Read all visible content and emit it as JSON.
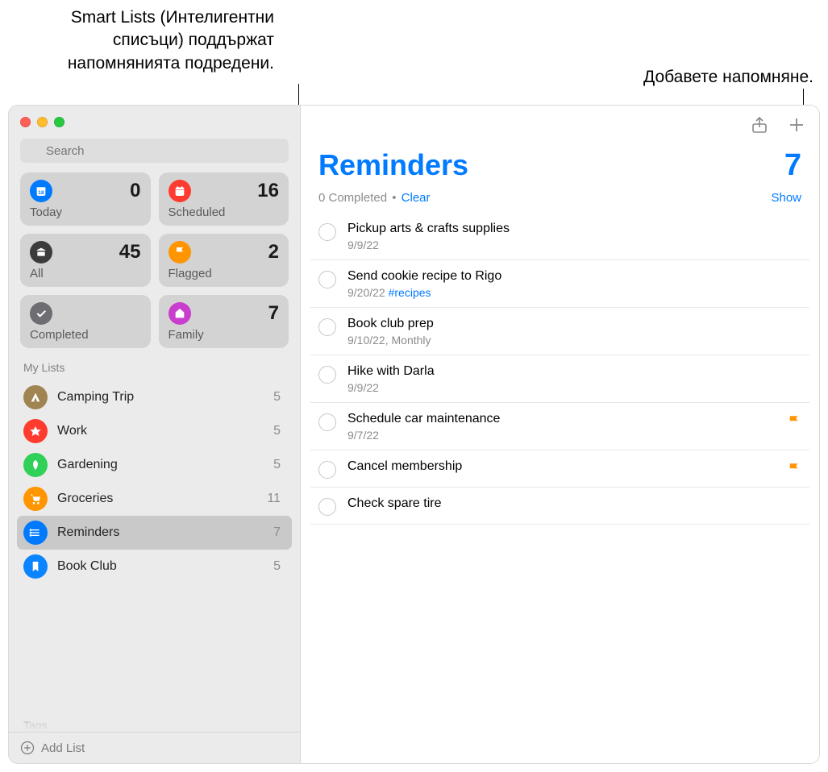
{
  "callouts": {
    "left": "Smart Lists (Интелигентни списъци) поддържат напомнянията подредени.",
    "right": "Добавете напомняне."
  },
  "sidebar": {
    "search_placeholder": "Search",
    "smart": [
      {
        "label": "Today",
        "count": "0",
        "icon": "today"
      },
      {
        "label": "Scheduled",
        "count": "16",
        "icon": "scheduled"
      },
      {
        "label": "All",
        "count": "45",
        "icon": "all"
      },
      {
        "label": "Flagged",
        "count": "2",
        "icon": "flagged"
      },
      {
        "label": "Completed",
        "count": "",
        "icon": "completed"
      },
      {
        "label": "Family",
        "count": "7",
        "icon": "family"
      }
    ],
    "my_lists_title": "My Lists",
    "lists": [
      {
        "name": "Camping Trip",
        "count": "5",
        "cls": "ic-camping"
      },
      {
        "name": "Work",
        "count": "5",
        "cls": "ic-work"
      },
      {
        "name": "Gardening",
        "count": "5",
        "cls": "ic-garden"
      },
      {
        "name": "Groceries",
        "count": "11",
        "cls": "ic-groc"
      },
      {
        "name": "Reminders",
        "count": "7",
        "cls": "ic-remind",
        "selected": true
      },
      {
        "name": "Book Club",
        "count": "5",
        "cls": "ic-book"
      }
    ],
    "tags_title": "Tags",
    "add_list": "Add List"
  },
  "content": {
    "title": "Reminders",
    "count": "7",
    "completed_text": "0 Completed",
    "clear": "Clear",
    "show": "Show",
    "items": [
      {
        "title": "Pickup arts & crafts supplies",
        "meta": "9/9/22",
        "tag": "",
        "flag": false
      },
      {
        "title": "Send cookie recipe to Rigo",
        "meta": "9/20/22 ",
        "tag": "#recipes",
        "flag": false
      },
      {
        "title": "Book club prep",
        "meta": "9/10/22, Monthly",
        "tag": "",
        "flag": false
      },
      {
        "title": "Hike with Darla",
        "meta": "9/9/22",
        "tag": "",
        "flag": false
      },
      {
        "title": "Schedule car maintenance",
        "meta": "9/7/22",
        "tag": "",
        "flag": true
      },
      {
        "title": "Cancel membership",
        "meta": "",
        "tag": "",
        "flag": true
      },
      {
        "title": "Check spare tire",
        "meta": "",
        "tag": "",
        "flag": false
      }
    ]
  }
}
